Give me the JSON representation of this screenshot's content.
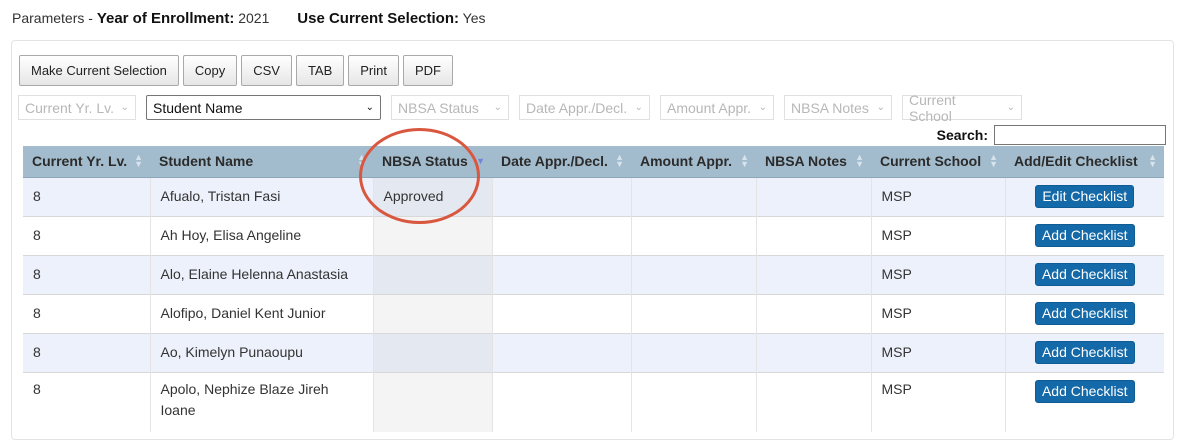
{
  "params": {
    "prefix": "Parameters -",
    "year_label": "Year of Enrollment:",
    "year_value": "2021",
    "use_label": "Use Current Selection:",
    "use_value": "Yes"
  },
  "toolbar": {
    "buttons": [
      "Make Current Selection",
      "Copy",
      "CSV",
      "TAB",
      "Print",
      "PDF"
    ]
  },
  "filters": [
    {
      "label": "Current Yr. Lv.",
      "active": false
    },
    {
      "label": "Student Name",
      "active": true
    },
    {
      "label": "NBSA Status",
      "active": false
    },
    {
      "label": "Date Appr./Decl.",
      "active": false
    },
    {
      "label": "Amount Appr.",
      "active": false
    },
    {
      "label": "NBSA Notes",
      "active": false
    },
    {
      "label": "Current School",
      "active": false
    }
  ],
  "search": {
    "label": "Search:",
    "value": ""
  },
  "table": {
    "columns": [
      "Current Yr. Lv.",
      "Student Name",
      "NBSA Status",
      "Date Appr./Decl.",
      "Amount Appr.",
      "NBSA Notes",
      "Current School",
      "Add/Edit Checklist"
    ],
    "sorted_column": "NBSA Status",
    "rows": [
      {
        "yr": "8",
        "name": "Afualo, Tristan Fasi",
        "status": "Approved",
        "date": "",
        "amount": "",
        "notes": "",
        "school": "MSP",
        "action": "Edit Checklist"
      },
      {
        "yr": "8",
        "name": "Ah Hoy, Elisa Angeline",
        "status": "",
        "date": "",
        "amount": "",
        "notes": "",
        "school": "MSP",
        "action": "Add Checklist"
      },
      {
        "yr": "8",
        "name": "Alo, Elaine Helenna Anastasia",
        "status": "",
        "date": "",
        "amount": "",
        "notes": "",
        "school": "MSP",
        "action": "Add Checklist"
      },
      {
        "yr": "8",
        "name": "Alofipo, Daniel Kent Junior",
        "status": "",
        "date": "",
        "amount": "",
        "notes": "",
        "school": "MSP",
        "action": "Add Checklist"
      },
      {
        "yr": "8",
        "name": "Ao, Kimelyn Punaoupu",
        "status": "",
        "date": "",
        "amount": "",
        "notes": "",
        "school": "MSP",
        "action": "Add Checklist"
      },
      {
        "yr": "8",
        "name": "Apolo, Nephize Blaze Jireh Ioane",
        "status": "",
        "date": "",
        "amount": "",
        "notes": "",
        "school": "MSP",
        "action": "Add Checklist"
      }
    ]
  },
  "colors": {
    "header_bg": "#a3bccd",
    "button_blue": "#1469a8",
    "annotation_red": "#d9573f"
  }
}
